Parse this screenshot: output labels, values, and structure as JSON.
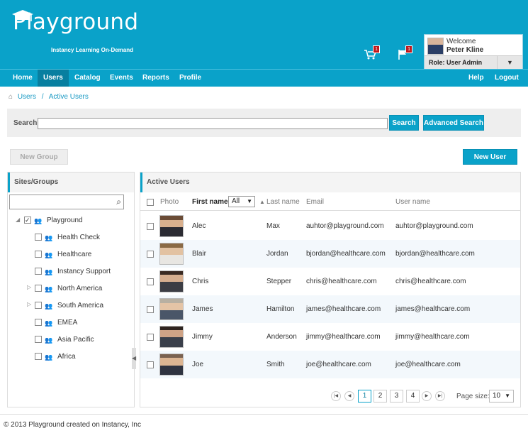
{
  "brand": {
    "name": "Playground",
    "tagline": "Instancy Learning On-Demand"
  },
  "header": {
    "cart_count": "1",
    "flag_count": "1"
  },
  "user": {
    "welcome": "Welcome",
    "name": "Peter Kline",
    "role": "Role: User Admin"
  },
  "nav": {
    "left": [
      "Home",
      "Users",
      "Catalog",
      "Events",
      "Reports",
      "Profile"
    ],
    "right": [
      "Help",
      "Logout"
    ],
    "active": "Users"
  },
  "breadcrumb": {
    "root": "Users",
    "separator": "/",
    "current": "Active Users"
  },
  "search": {
    "label": "Search:",
    "value": "",
    "button": "Search",
    "advanced": "Advanced Search"
  },
  "actions": {
    "new_group": "New Group",
    "new_user": "New User"
  },
  "sites": {
    "title": "Sites/Groups",
    "search_value": "",
    "tree": [
      {
        "label": "Playground",
        "checked": true
      },
      {
        "label": "Health Check",
        "checked": false
      },
      {
        "label": "Healthcare",
        "checked": false
      },
      {
        "label": "Instancy Support",
        "checked": false
      },
      {
        "label": "North America",
        "checked": false
      },
      {
        "label": "South America",
        "checked": false
      },
      {
        "label": "EMEA",
        "checked": false
      },
      {
        "label": "Asia Pacific",
        "checked": false
      },
      {
        "label": "Africa",
        "checked": false
      }
    ]
  },
  "users": {
    "title": "Active Users",
    "columns": {
      "photo": "Photo",
      "first": "First name",
      "filter": "All",
      "last": "Last name",
      "email": "Email",
      "username": "User name"
    },
    "rows": [
      {
        "first": "Alec",
        "last": "Max",
        "email": "auhtor@playground.com",
        "username": "auhtor@playground.com"
      },
      {
        "first": "Blair",
        "last": "Jordan",
        "email": "bjordan@healthcare.com",
        "username": "bjordan@healthcare.com"
      },
      {
        "first": "Chris",
        "last": "Stepper",
        "email": "chris@healthcare.com",
        "username": "chris@healthcare.com"
      },
      {
        "first": "James",
        "last": "Hamilton",
        "email": "james@healthcare.com",
        "username": "james@healthcare.com"
      },
      {
        "first": "Jimmy",
        "last": "Anderson",
        "email": "jimmy@healthcare.com",
        "username": "jimmy@healthcare.com"
      },
      {
        "first": "Joe",
        "last": "Smith",
        "email": "joe@healthcare.com",
        "username": "joe@healthcare.com"
      }
    ]
  },
  "pager": {
    "pages": [
      "1",
      "2",
      "3",
      "4"
    ],
    "current": "1",
    "page_size_label": "Page size:",
    "page_size": "10"
  },
  "footer": {
    "text": "© 2013 Playground created on Instancy, Inc"
  }
}
